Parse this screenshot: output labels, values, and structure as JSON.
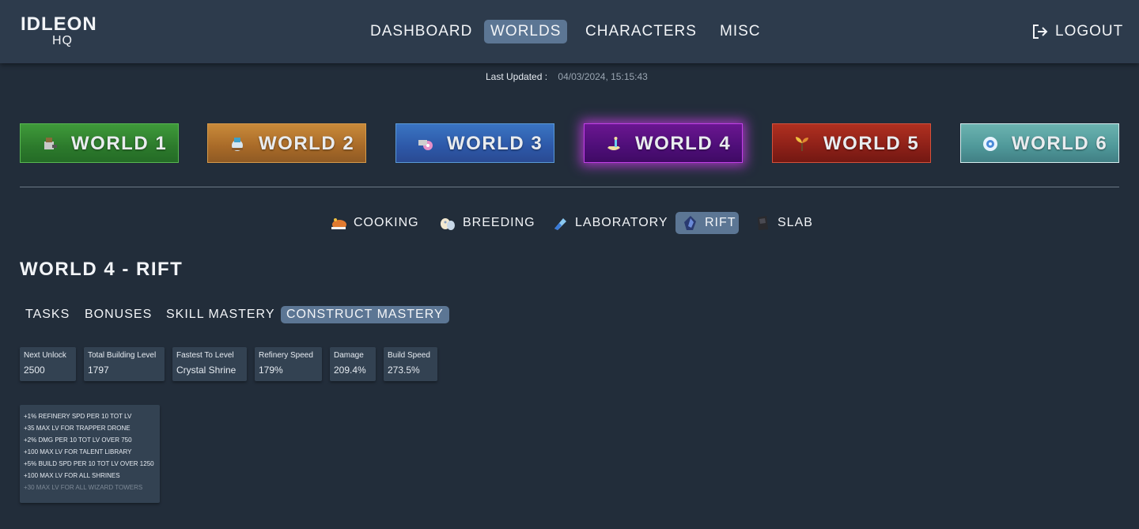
{
  "header": {
    "logo_line1": "IDLEON",
    "logo_line2": "HQ",
    "nav": [
      {
        "label": "DASHBOARD",
        "active": false
      },
      {
        "label": "WORLDS",
        "active": true
      },
      {
        "label": "CHARACTERS",
        "active": false
      },
      {
        "label": "MISC",
        "active": false
      }
    ],
    "logout_label": "LOGOUT",
    "logout_icon": "logout-icon"
  },
  "last_updated": {
    "label": "Last Updated :",
    "value": "04/03/2024, 15:15:43"
  },
  "worlds": [
    {
      "label": "WORLD 1",
      "icon": "world-1-icon",
      "color": "#2c7a2c"
    },
    {
      "label": "WORLD 2",
      "icon": "world-2-icon",
      "color": "#a86a28"
    },
    {
      "label": "WORLD 3",
      "icon": "world-3-icon",
      "color": "#2d58a8"
    },
    {
      "label": "WORLD 4",
      "icon": "world-4-icon",
      "color": "#4e0e78",
      "active": true
    },
    {
      "label": "WORLD 5",
      "icon": "world-5-icon",
      "color": "#8c2018"
    },
    {
      "label": "WORLD 6",
      "icon": "world-6-icon",
      "color": "#4f9899"
    }
  ],
  "subnav": [
    {
      "label": "COOKING",
      "icon": "cooking-icon"
    },
    {
      "label": "BREEDING",
      "icon": "egg-icon"
    },
    {
      "label": "LABORATORY",
      "icon": "vial-icon"
    },
    {
      "label": "RIFT",
      "icon": "rift-icon",
      "active": true
    },
    {
      "label": "SLAB",
      "icon": "slab-icon"
    }
  ],
  "page_title": "WORLD 4 - RIFT",
  "tabs": [
    {
      "label": "TASKS",
      "active": false
    },
    {
      "label": "BONUSES",
      "active": false
    },
    {
      "label": "SKILL MASTERY",
      "active": false
    },
    {
      "label": "CONSTRUCT MASTERY",
      "active": true
    }
  ],
  "stats": [
    {
      "label": "Next Unlock",
      "value": "2500"
    },
    {
      "label": "Total Building Level",
      "value": "1797"
    },
    {
      "label": "Fastest To Level",
      "value": "Crystal Shrine"
    },
    {
      "label": "Refinery Speed",
      "value": "179%"
    },
    {
      "label": "Damage",
      "value": "209.4%"
    },
    {
      "label": "Build Speed",
      "value": "273.5%"
    }
  ],
  "bonuses": [
    {
      "text": "+1% REFINERY SPD PER 10 TOT LV",
      "unlocked": true
    },
    {
      "text": "+35 MAX LV FOR TRAPPER DRONE",
      "unlocked": true
    },
    {
      "text": "+2% DMG PER 10 TOT LV OVER 750",
      "unlocked": true
    },
    {
      "text": "+100 MAX LV FOR TALENT LIBRARY",
      "unlocked": true
    },
    {
      "text": "+5% BUILD SPD PER 10 TOT LV OVER 1250",
      "unlocked": true
    },
    {
      "text": "+100 MAX LV FOR ALL SHRINES",
      "unlocked": true
    },
    {
      "text": "+30 MAX LV FOR ALL WIZARD TOWERS",
      "unlocked": false
    }
  ]
}
